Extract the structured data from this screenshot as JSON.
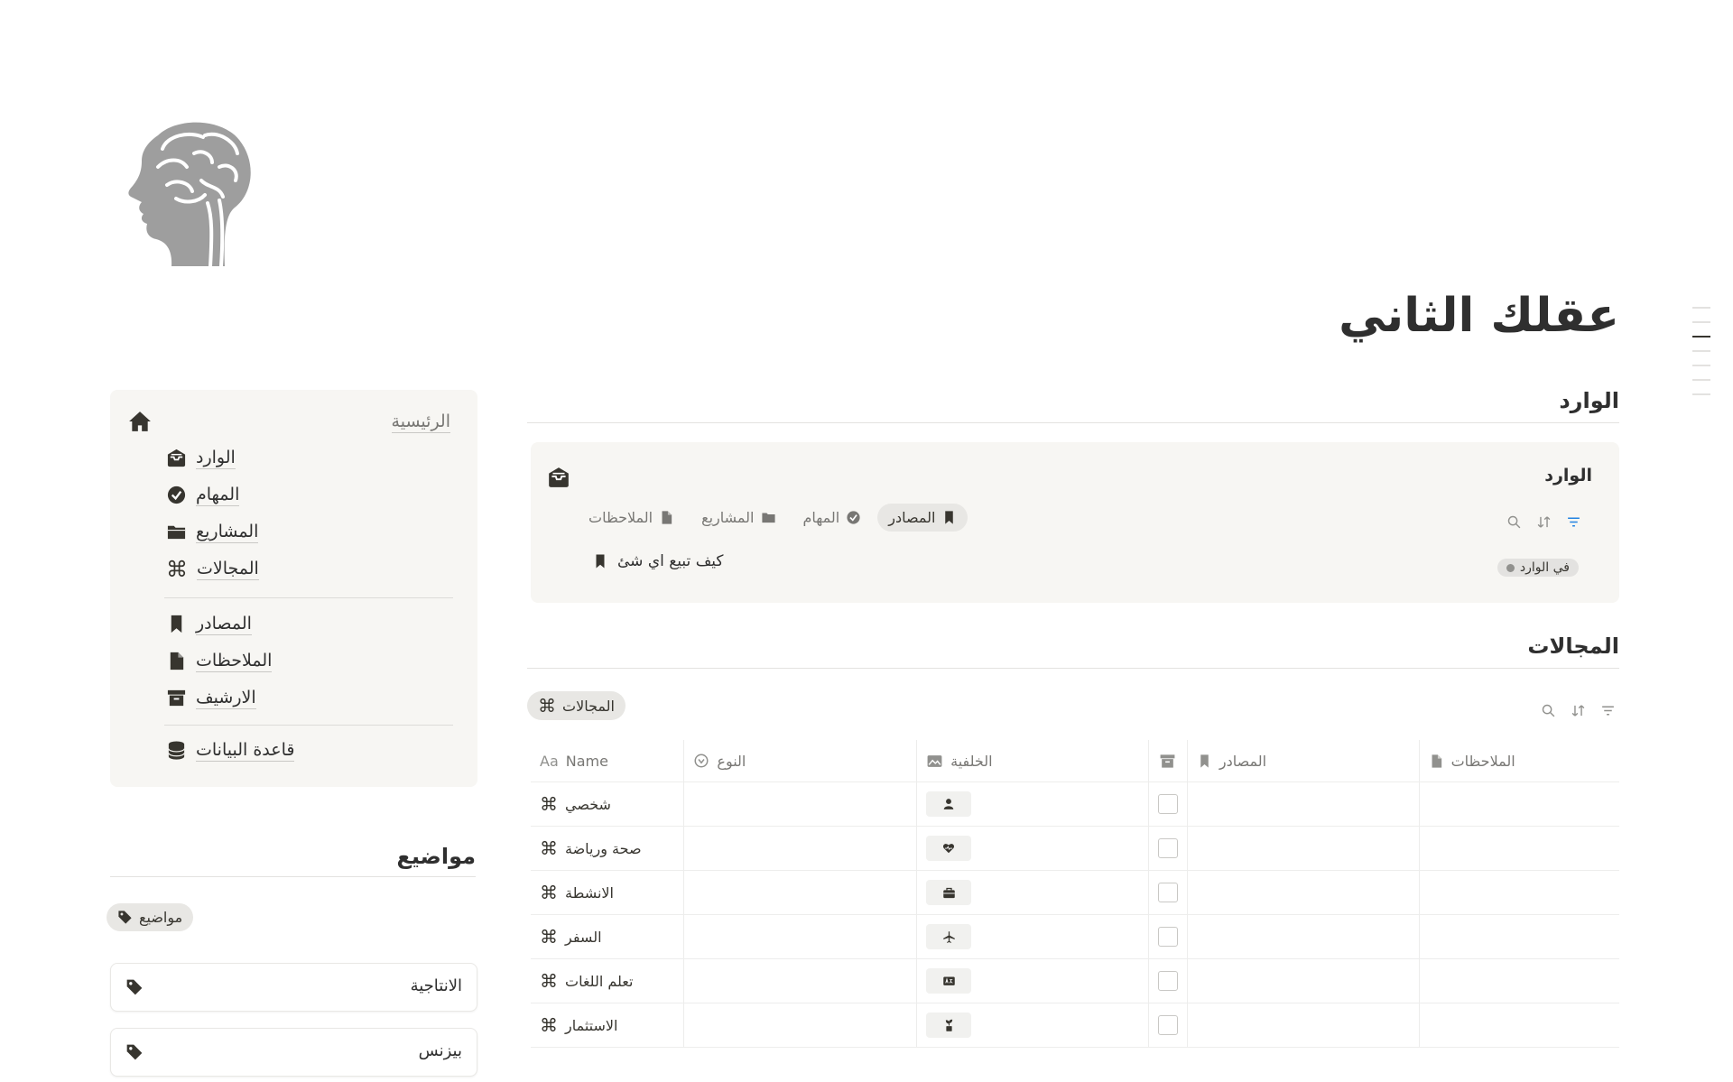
{
  "page": {
    "title": "عقلك الثاني"
  },
  "inbox": {
    "heading": "الوارد",
    "card_title": "الوارد",
    "tabs": [
      {
        "label": "الملاحظات",
        "icon": "document-icon"
      },
      {
        "label": "المشاريع",
        "icon": "folder-icon"
      },
      {
        "label": "المهام",
        "icon": "check-circle-icon"
      },
      {
        "label": "المصادر",
        "icon": "bookmark-icon",
        "active": true
      }
    ],
    "row": {
      "title": "كيف تبيع اي شئ",
      "status": "في الوارد"
    }
  },
  "areas": {
    "heading": "المجالات",
    "view_tab": "المجالات",
    "columns": {
      "name": "Name",
      "type": "النوع",
      "background": "الخلفية",
      "sources": "المصادر",
      "notes": "الملاحظات"
    },
    "rows": [
      {
        "name": "شخصي",
        "icon": "person-icon"
      },
      {
        "name": "صحة ورياضة",
        "icon": "heart-pulse-icon"
      },
      {
        "name": "الانشطة",
        "icon": "briefcase-icon"
      },
      {
        "name": "السفر",
        "icon": "airplane-icon"
      },
      {
        "name": "تعلم اللغات",
        "icon": "translate-icon"
      },
      {
        "name": "الاستثمار",
        "icon": "plant-coin-icon"
      }
    ]
  },
  "nav": {
    "home": "الرئيسية",
    "items": [
      {
        "label": "الوارد",
        "icon": "inbox-icon"
      },
      {
        "label": "المهام",
        "icon": "check-circle-icon"
      },
      {
        "label": "المشاريع",
        "icon": "folder-icon"
      },
      {
        "label": "المجالات",
        "icon": "command-icon"
      },
      {
        "label": "المصادر",
        "icon": "bookmark-icon"
      },
      {
        "label": "الملاحظات",
        "icon": "document-icon"
      },
      {
        "label": "الارشيف",
        "icon": "archive-icon"
      },
      {
        "label": "قاعدة البيانات",
        "icon": "database-icon"
      }
    ]
  },
  "topics": {
    "heading": "مواضيع",
    "view_tab": "مواضيع",
    "items": [
      "الانتاجية",
      "بيزنس"
    ]
  }
}
